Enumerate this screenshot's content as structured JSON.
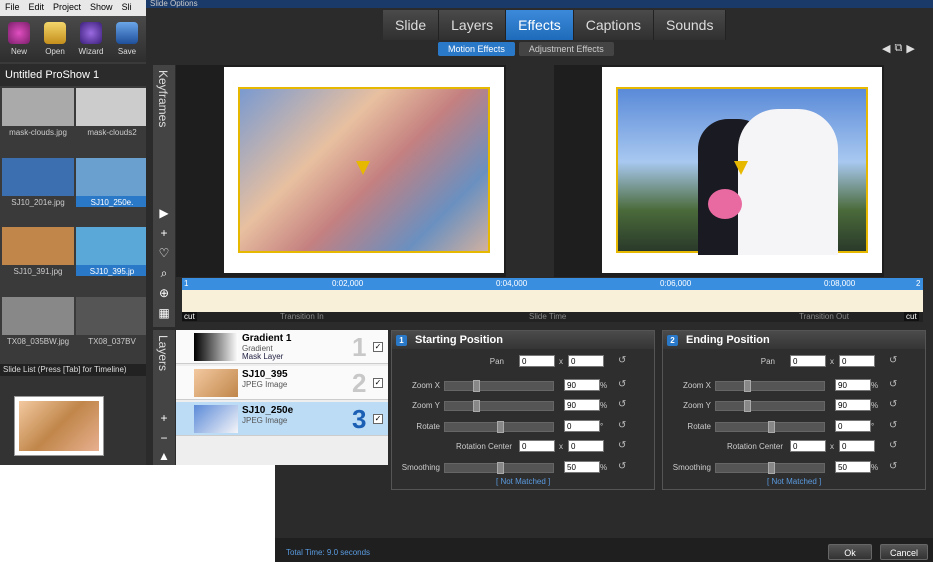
{
  "app": {
    "menu": [
      "File",
      "Edit",
      "Project",
      "Show",
      "Sli"
    ],
    "toolbar": [
      "New",
      "Open",
      "Wizard",
      "Save"
    ],
    "project_name": "Untitled ProShow 1",
    "thumbs": [
      {
        "name": "mask-clouds.jpg",
        "color": "#aaa"
      },
      {
        "name": "mask-clouds2",
        "color": "#ccc"
      },
      {
        "name": "SJ10_201e.jpg",
        "color": "#3b6fb0"
      },
      {
        "name": "SJ10_250e.",
        "color": "#6aa0d0",
        "selected": true
      },
      {
        "name": "SJ10_391.jpg",
        "color": "#c0864a"
      },
      {
        "name": "SJ10_395.jp",
        "color": "#5aa8d8",
        "selected": true
      },
      {
        "name": "TX08_035BW.jpg",
        "color": "#888"
      },
      {
        "name": "TX08_037BV",
        "color": "#555"
      }
    ],
    "slide_list": "Slide List (Press [Tab] for Timeline)"
  },
  "dialog": {
    "title": "Slide Options",
    "tabs": [
      "Slide",
      "Layers",
      "Effects",
      "Captions",
      "Sounds"
    ],
    "active_tab": "Effects",
    "subtabs": [
      "Motion Effects",
      "Adjustment Effects"
    ],
    "keyframes_label": "Keyframes",
    "layers_label": "Layers",
    "timeline": {
      "marks": [
        "1",
        "0:02,000",
        "0:04,000",
        "0:06,000",
        "0:08,000",
        "2"
      ],
      "labels": [
        "Transition In",
        "Slide Time",
        "Transition Out"
      ],
      "cut": "cut"
    },
    "layers": [
      {
        "name": "Gradient 1",
        "type": "Gradient",
        "sub": "Mask Layer",
        "num": "1",
        "checked": "✓"
      },
      {
        "name": "SJ10_395",
        "type": "JPEG Image",
        "sub": "",
        "num": "2",
        "checked": "✓"
      },
      {
        "name": "SJ10_250e",
        "type": "JPEG Image",
        "sub": "",
        "num": "3",
        "checked": "✓",
        "selected": true
      }
    ],
    "panels": [
      {
        "badge": "1",
        "title": "Starting Position",
        "pan_x": "0",
        "pan_y": "0",
        "zoom_x": "90",
        "zoom_y": "90",
        "rotate": "0",
        "rc_x": "0",
        "rc_y": "0",
        "smoothing": "50"
      },
      {
        "badge": "2",
        "title": "Ending Position",
        "pan_x": "0",
        "pan_y": "0",
        "zoom_x": "90",
        "zoom_y": "90",
        "rotate": "0",
        "rc_x": "0",
        "rc_y": "0",
        "smoothing": "50"
      }
    ],
    "field_labels": {
      "pan": "Pan",
      "zoom_x": "Zoom X",
      "zoom_y": "Zoom Y",
      "rotate": "Rotate",
      "rotation_center": "Rotation Center",
      "smoothing": "Smoothing",
      "x": "x",
      "pct": "%",
      "deg": "°"
    },
    "not_matched": "[ Not Matched ]",
    "total_time": "Total Time: 9.0 seconds",
    "ok": "Ok",
    "cancel": "Cancel"
  }
}
